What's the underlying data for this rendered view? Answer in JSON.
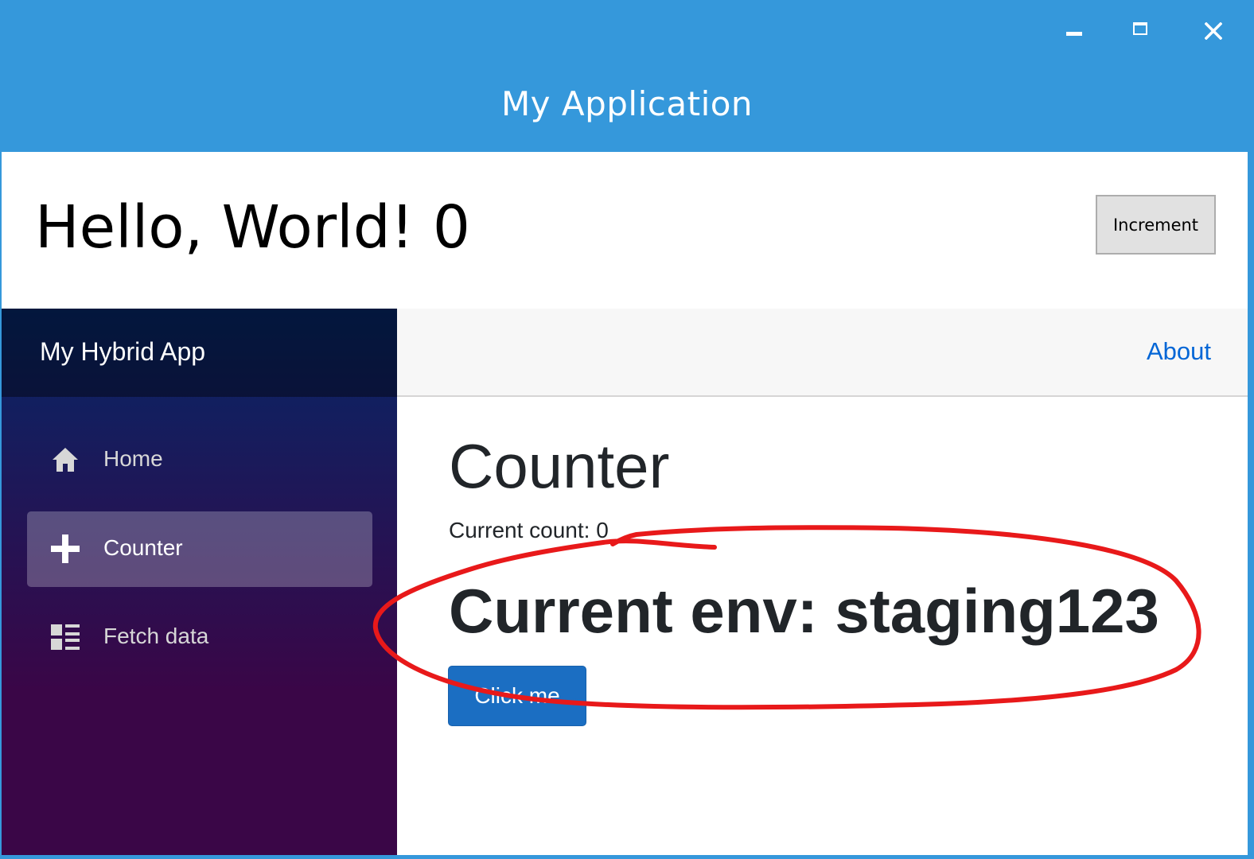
{
  "window": {
    "title": "My Application",
    "controls": {
      "minimize": "minimize-icon",
      "maximize": "maximize-icon",
      "close": "close-icon"
    },
    "accent_color": "#3598db"
  },
  "native_header": {
    "greeting": "Hello, World! 0",
    "increment_label": "Increment"
  },
  "sidebar": {
    "brand": "My Hybrid App",
    "items": [
      {
        "label": "Home",
        "icon": "home-icon",
        "active": false
      },
      {
        "label": "Counter",
        "icon": "plus-icon",
        "active": true
      },
      {
        "label": "Fetch data",
        "icon": "list-icon",
        "active": false
      }
    ]
  },
  "topbar": {
    "about_label": "About"
  },
  "main": {
    "title": "Counter",
    "current_count": "Current count: 0",
    "current_env": "Current env: staging123",
    "button_label": "Click me",
    "button_color": "#1b6ec2"
  },
  "annotation": {
    "shape": "red-freehand-ellipse",
    "color": "#e8191a"
  }
}
